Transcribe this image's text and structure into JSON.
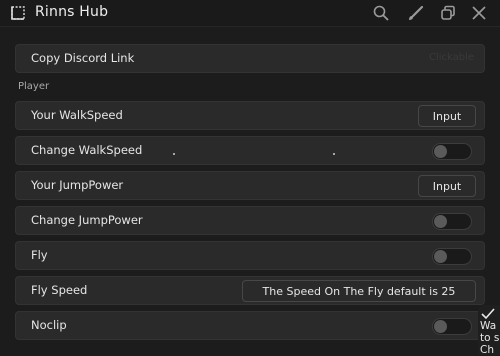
{
  "app": {
    "title": "Rinns Hub"
  },
  "titlebar_icons": [
    "search-icon",
    "brush-icon",
    "restore-window-icon",
    "close-icon"
  ],
  "rows": {
    "copy_discord": {
      "label": "Copy Discord Link",
      "hint": "Clickable"
    },
    "section_player": "Player",
    "walkspeed": {
      "label": "Your WalkSpeed",
      "input_placeholder": "Input"
    },
    "change_walkspeed": {
      "label": "Change WalkSpeed",
      "toggle_on": false
    },
    "jumppower": {
      "label": "Your JumpPower",
      "input_placeholder": "Input"
    },
    "change_jumppower": {
      "label": "Change JumpPower",
      "toggle_on": false
    },
    "fly": {
      "label": "Fly",
      "toggle_on": false
    },
    "fly_speed": {
      "label": "Fly Speed",
      "input_placeholder": "The Speed On The Fly default is 25"
    },
    "noclip": {
      "label": "Noclip",
      "toggle_on": false
    }
  },
  "notification": {
    "line1": "Wa",
    "line2": "to s",
    "line3": "Ch"
  },
  "colors": {
    "background": "#1c1c1c",
    "row": "#2a2a2a",
    "text": "#e6e6e6"
  }
}
